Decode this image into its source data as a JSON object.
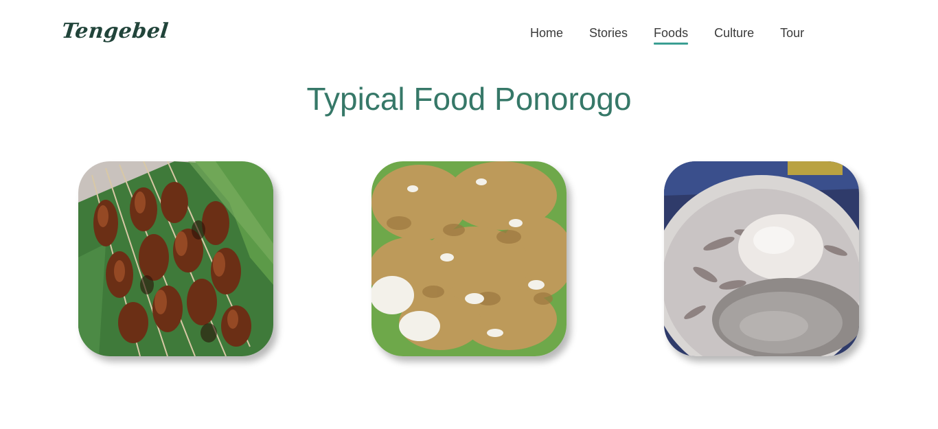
{
  "brand": {
    "logo_text": "Tengebel"
  },
  "nav": {
    "items": [
      {
        "label": "Home",
        "active": false
      },
      {
        "label": "Stories",
        "active": false
      },
      {
        "label": "Foods",
        "active": true
      },
      {
        "label": "Culture",
        "active": false
      },
      {
        "label": "Tour",
        "active": false
      }
    ]
  },
  "main": {
    "title": "Typical Food Ponorogo"
  },
  "colors": {
    "accent": "#3a9e92",
    "title": "#367868",
    "logo": "#21443a"
  },
  "cards": [
    {
      "icon": "sate-skewers-photo"
    },
    {
      "icon": "tiwul-cassava-photo"
    },
    {
      "icon": "dawet-drink-photo"
    }
  ]
}
